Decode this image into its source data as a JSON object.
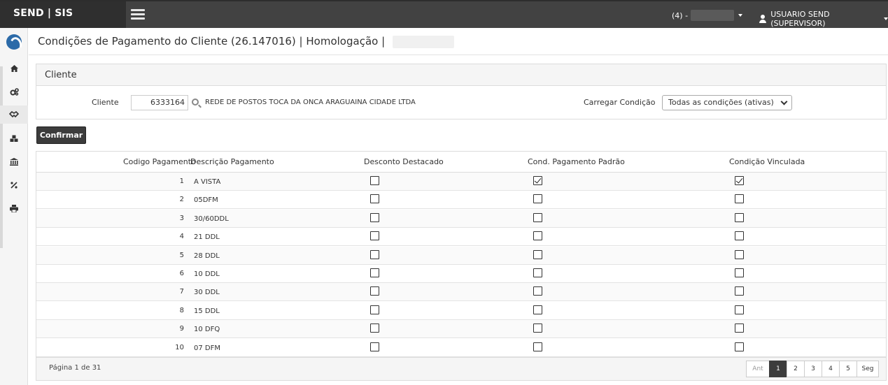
{
  "topbar": {
    "brand": "SEND | SIS",
    "branch_label": "(4) -",
    "user_label": "USUARIO SEND (SUPERVISOR)"
  },
  "sidebar": {
    "items": [
      {
        "icon": "home-icon"
      },
      {
        "icon": "cogs-icon"
      },
      {
        "icon": "handshake-icon"
      },
      {
        "icon": "cubes-icon"
      },
      {
        "icon": "bank-icon"
      },
      {
        "icon": "percent-icon"
      },
      {
        "icon": "print-icon"
      }
    ]
  },
  "header": {
    "title": "Condições de Pagamento do Cliente (26.147016)",
    "separator1": "|",
    "environment": "Homologação",
    "separator2": "|"
  },
  "cliente_panel": {
    "heading": "Cliente",
    "cliente_label": "Cliente",
    "cliente_code": "6333164",
    "cliente_name": "REDE DE POSTOS TOCA DA ONCA ARAGUAINA CIDADE LTDA",
    "carregar_label": "Carregar Condição",
    "carregar_value": "Todas as condições (ativas)"
  },
  "actions": {
    "confirm_label": "Confirmar"
  },
  "grid": {
    "columns": [
      "Codigo Pagamento",
      "Descrição Pagamento",
      "Desconto Destacado",
      "Cond. Pagamento Padrão",
      "Condição Vinculada"
    ],
    "rows": [
      {
        "code": "1",
        "desc": "A VISTA",
        "desconto": false,
        "padrao": true,
        "vinculada": true
      },
      {
        "code": "2",
        "desc": "05DFM",
        "desconto": false,
        "padrao": false,
        "vinculada": false
      },
      {
        "code": "3",
        "desc": "30/60DDL",
        "desconto": false,
        "padrao": false,
        "vinculada": false
      },
      {
        "code": "4",
        "desc": "21 DDL",
        "desconto": false,
        "padrao": false,
        "vinculada": false
      },
      {
        "code": "5",
        "desc": "28 DDL",
        "desconto": false,
        "padrao": false,
        "vinculada": false
      },
      {
        "code": "6",
        "desc": "10 DDL",
        "desconto": false,
        "padrao": false,
        "vinculada": false
      },
      {
        "code": "7",
        "desc": "30 DDL",
        "desconto": false,
        "padrao": false,
        "vinculada": false
      },
      {
        "code": "8",
        "desc": "15 DDL",
        "desconto": false,
        "padrao": false,
        "vinculada": false
      },
      {
        "code": "9",
        "desc": "10 DFQ",
        "desconto": false,
        "padrao": false,
        "vinculada": false
      },
      {
        "code": "10",
        "desc": "07 DFM",
        "desconto": false,
        "padrao": false,
        "vinculada": false
      }
    ],
    "page_info": "Página 1 de 31",
    "pager": {
      "prev": "Ant",
      "pages": [
        "1",
        "2",
        "3",
        "4",
        "5"
      ],
      "current": "1",
      "next": "Seg"
    }
  }
}
